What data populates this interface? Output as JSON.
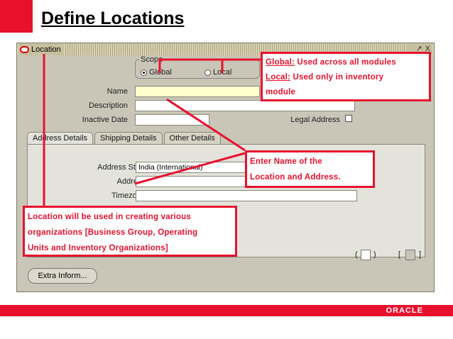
{
  "slide_title": "Define Locations",
  "window": {
    "title": "Location",
    "controls": [
      "_",
      "↗",
      "X"
    ]
  },
  "form": {
    "scope_label": "Scope",
    "scope_global": "Global",
    "scope_local": "Local",
    "name_label": "Name",
    "name_value": "",
    "description_label": "Description",
    "description_value": "",
    "inactive_date_label": "Inactive Date",
    "inactive_date_value": "",
    "legal_address_label": "Legal Address"
  },
  "tabs": [
    "Address Details",
    "Shipping Details",
    "Other Details"
  ],
  "address": {
    "style_label": "Address Style",
    "style_value": "India (International)",
    "address_label": "Address",
    "address_value": "",
    "timezone_label": "Timezone",
    "timezone_value": ""
  },
  "bottom": {
    "paren_open": "(",
    "paren_close": ")",
    "bracket_open": "[",
    "bracket_close": "]",
    "extra_button": "Extra Inform..."
  },
  "annotations": {
    "scope_global_term": "Global:",
    "scope_global_text": " Used across all modules",
    "scope_local_term": "Local:",
    "scope_local_text": " Used only in inventory",
    "scope_line3": "module",
    "name_line1": "Enter Name of the",
    "name_line2": "Location and Address.",
    "location_line1": "Location will be used in creating various",
    "location_line2": "organizations [Business Group, Operating",
    "location_line3": "Units and Inventory Organizations]"
  },
  "footer": {
    "brand": "ORACLE"
  },
  "colors": {
    "accent_red": "#e8112d",
    "window_bg": "#c9c6b7"
  }
}
